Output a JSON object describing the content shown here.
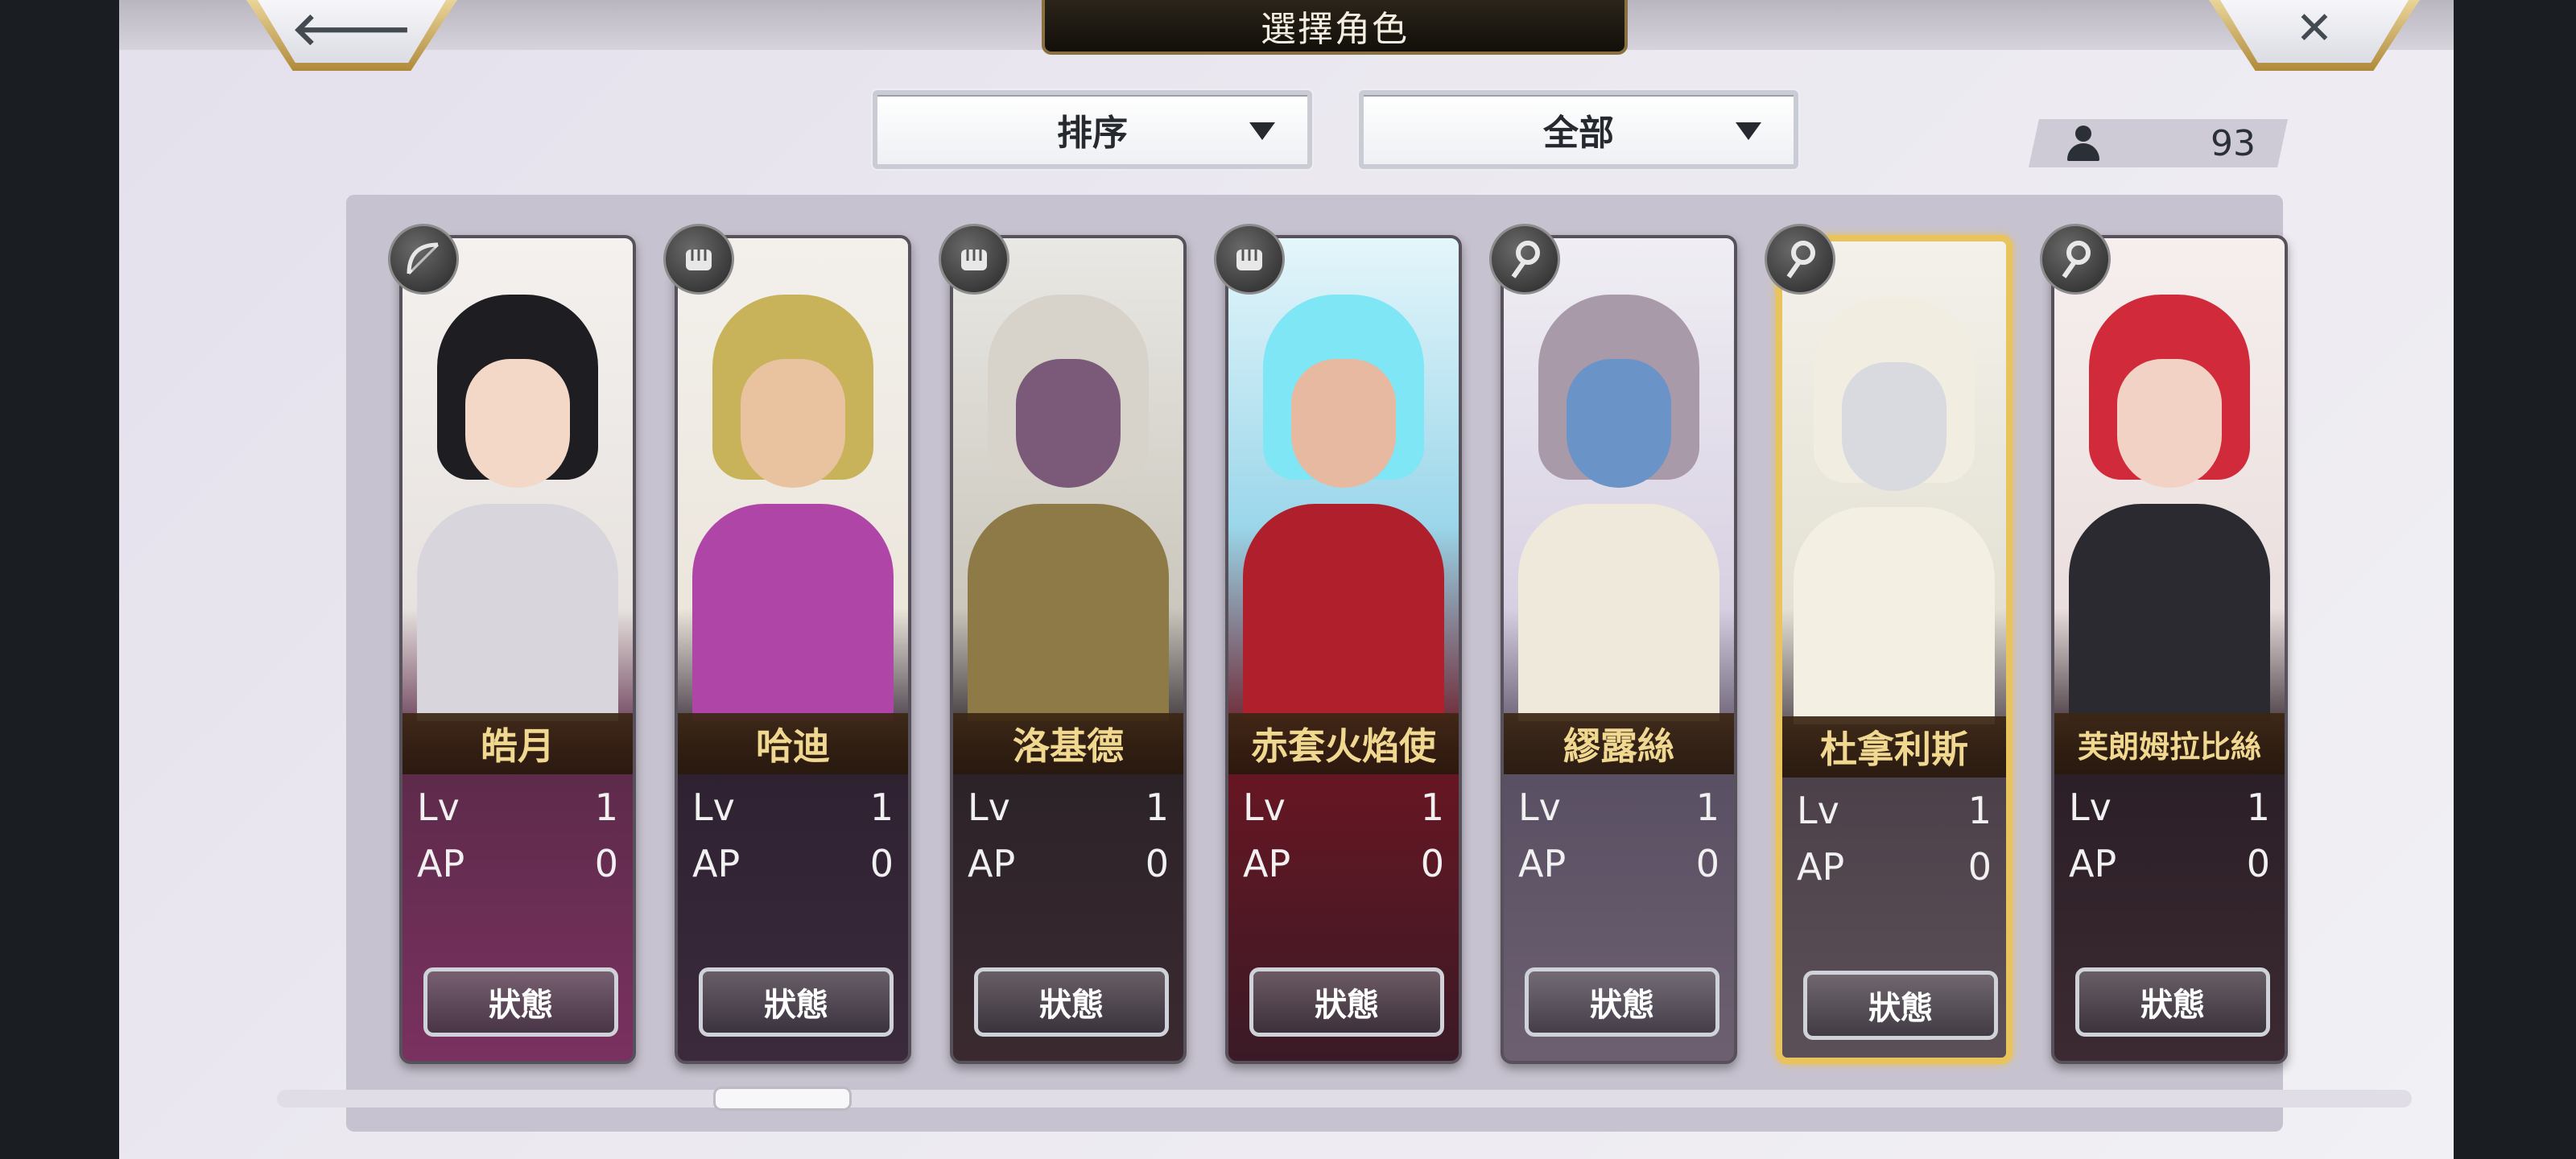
{
  "header": {
    "title": "選擇角色",
    "back_icon": "back-arrow-icon",
    "close_icon": "close-icon"
  },
  "filters": {
    "sort_label": "排序",
    "category_label": "全部"
  },
  "roster_count": "93",
  "status_button_label": "狀態",
  "stat_labels": {
    "lv": "Lv",
    "ap": "AP"
  },
  "characters": [
    {
      "name": "皓月",
      "lv": "1",
      "ap": "0",
      "weapon": "bow-icon",
      "selected": false
    },
    {
      "name": "哈迪",
      "lv": "1",
      "ap": "0",
      "weapon": "fist-icon",
      "selected": false
    },
    {
      "name": "洛基德",
      "lv": "1",
      "ap": "0",
      "weapon": "fist-icon",
      "selected": false
    },
    {
      "name": "赤套火焰使",
      "lv": "1",
      "ap": "0",
      "weapon": "fist-icon",
      "selected": false
    },
    {
      "name": "繆露絲",
      "lv": "1",
      "ap": "0",
      "weapon": "staff-icon",
      "selected": false
    },
    {
      "name": "杜拿利斯",
      "lv": "1",
      "ap": "0",
      "weapon": "staff-icon",
      "selected": true
    },
    {
      "name": "芙朗姆拉比絲",
      "lv": "1",
      "ap": "0",
      "weapon": "staff-icon",
      "selected": false
    }
  ],
  "colors": {
    "accent_gold": "#e9c35b",
    "name_text": "#f1d891",
    "panel": "#c7c2cf"
  }
}
